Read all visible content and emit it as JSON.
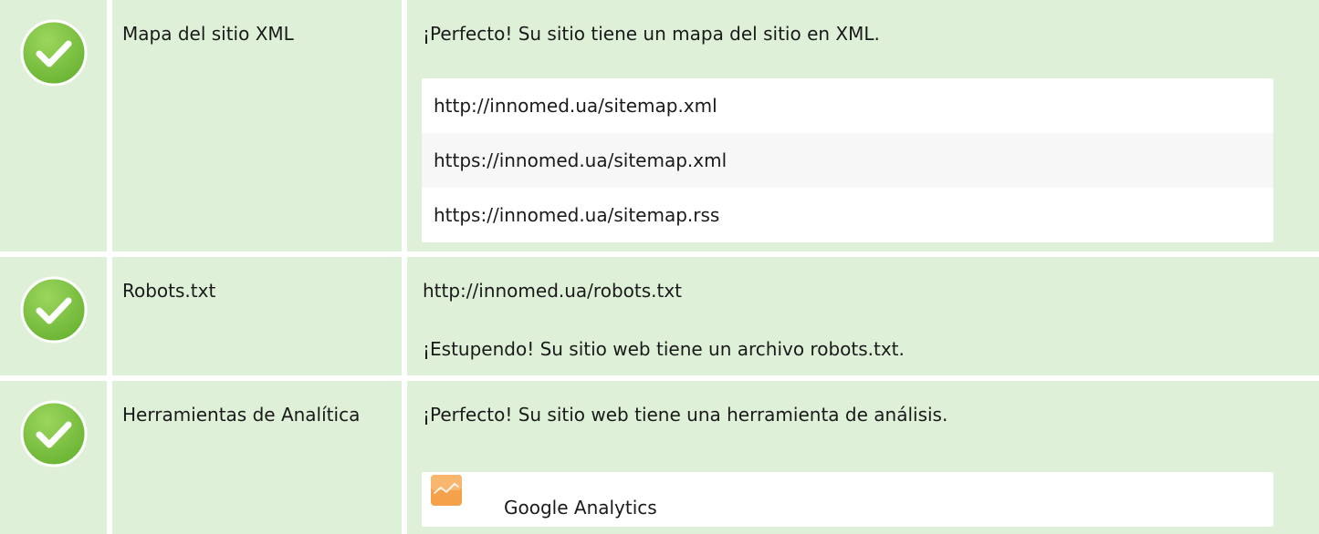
{
  "colors": {
    "row_background": "#dff0d8",
    "check_green": "#7dc243",
    "tool_icon_orange": "#f5a14c"
  },
  "icons": {
    "status": "check-circle-icon",
    "analytics": "google-analytics-icon"
  },
  "rows": [
    {
      "label": "Mapa del sitio XML",
      "message": "¡Perfecto! Su sitio tiene un mapa del sitio en XML.",
      "urls": [
        "http://innomed.ua/sitemap.xml",
        "https://innomed.ua/sitemap.xml",
        "https://innomed.ua/sitemap.rss"
      ]
    },
    {
      "label": "Robots.txt",
      "url": "http://innomed.ua/robots.txt",
      "message": "¡Estupendo! Su sitio web tiene un archivo robots.txt."
    },
    {
      "label": "Herramientas de Analítica",
      "message": "¡Perfecto! Su sitio web tiene una herramienta de análisis.",
      "tool": "Google Analytics"
    }
  ]
}
